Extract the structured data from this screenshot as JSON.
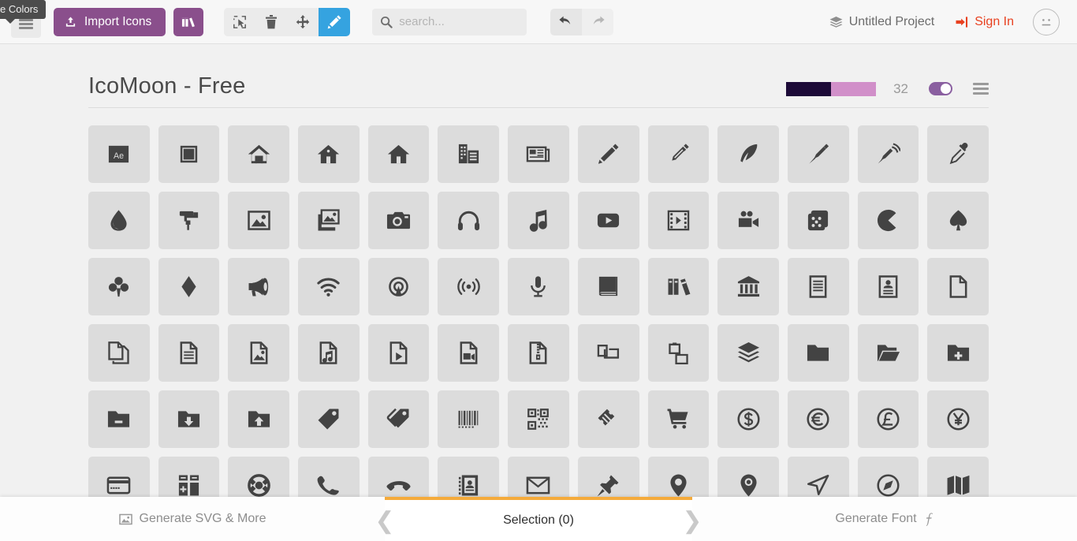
{
  "app": {
    "tooltip": "e Colors"
  },
  "toolbar": {
    "menu_icon": "hamburger-icon",
    "import_label": "Import Icons",
    "import_icon": "upload-icon",
    "library_icon": "books-icon",
    "tools": [
      {
        "name": "select",
        "icon": "cursor-select-icon",
        "active": false
      },
      {
        "name": "delete",
        "icon": "trash-icon",
        "active": false
      },
      {
        "name": "move",
        "icon": "move-icon",
        "active": false
      },
      {
        "name": "edit",
        "icon": "pencil-icon",
        "active": true
      }
    ],
    "active_tool_color": "#35a3e0",
    "purple": "#8a4f8c",
    "search_placeholder": "search...",
    "search_value": "",
    "search_icon": "search-icon",
    "undo_icon": "undo-arrow-icon",
    "redo_icon": "redo-arrow-icon",
    "project_label": "Untitled Project",
    "project_icon": "layers-icon",
    "signin_label": "Sign In",
    "signin_icon": "login-icon",
    "signin_color": "#e8401f",
    "avatar_icon": "neutral-face-avatar"
  },
  "set": {
    "title": "IcoMoon - Free",
    "color_a": "#1d0a38",
    "color_b": "#d18fc9",
    "count": "32",
    "toggle_on": true,
    "toggle_color": "#8a5fa0",
    "menu_icon": "set-menu-icon"
  },
  "icons": [
    "Ae",
    "square",
    "home",
    "home2",
    "home3",
    "office",
    "newspaper",
    "pencil",
    "pencil2",
    "quill",
    "pen",
    "blog",
    "eyedropper",
    "droplet",
    "paint-format",
    "image",
    "images",
    "camera",
    "headphones",
    "music",
    "play",
    "film",
    "video-camera",
    "dice",
    "pacman",
    "spades",
    "clubs",
    "diamonds",
    "bullhorn",
    "connection",
    "podcast",
    "feed",
    "mic",
    "book",
    "books",
    "library",
    "file-text2",
    "profile",
    "file-empty",
    "copy",
    "file-text",
    "file-picture",
    "file-music",
    "file-play",
    "file-video",
    "file-zip",
    "copy2",
    "paste",
    "stack",
    "folder",
    "folder-open",
    "folder-plus",
    "folder-minus",
    "folder-download",
    "folder-upload",
    "price-tag",
    "price-tags",
    "barcode",
    "qrcode",
    "ticket",
    "cart",
    "coin-dollar",
    "coin-euro",
    "coin-pound",
    "coin-yen",
    "credit-card",
    "calculator",
    "lifebuoy",
    "phone",
    "phone-hang-up",
    "address-book",
    "envelop",
    "pushpin",
    "location",
    "location2",
    "compass",
    "compass2",
    "map"
  ],
  "footer": {
    "left_label": "Generate SVG & More",
    "left_icon": "image-icon",
    "center_label": "Selection (0)",
    "right_label": "Generate Font",
    "right_icon": "font-f-icon",
    "accent": "#f5ab3c"
  }
}
